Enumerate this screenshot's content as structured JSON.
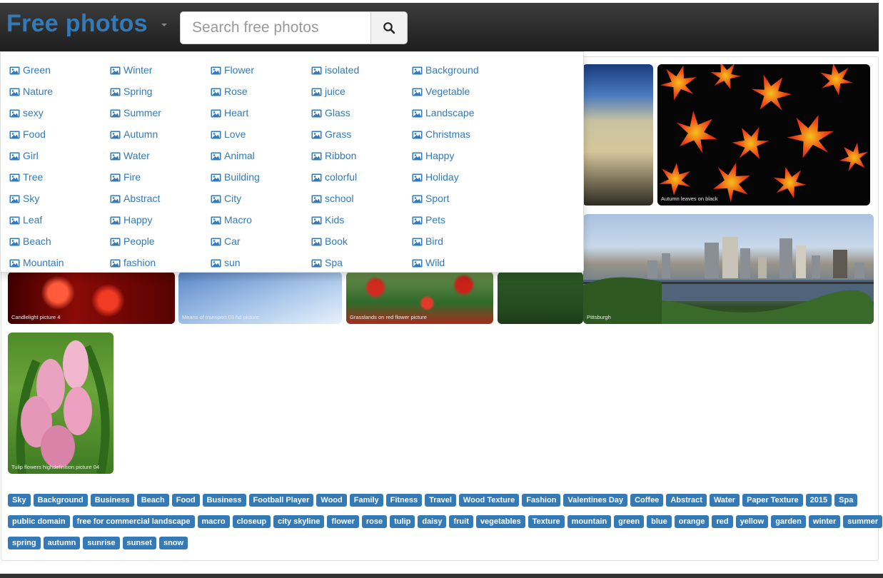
{
  "header": {
    "brand": "Free photos",
    "search_placeholder": "Search free photos"
  },
  "dropdown": {
    "columns": [
      [
        "Green",
        "Nature",
        "sexy",
        "Food",
        "Girl",
        "Tree",
        "Sky",
        "Leaf",
        "Beach",
        "Mountain"
      ],
      [
        "Winter",
        "Spring",
        "Summer",
        "Autumn",
        "Water",
        "Fire",
        "Abstract",
        "Happy",
        "People",
        "fashion"
      ],
      [
        "Flower",
        "Rose",
        "Heart",
        "Love",
        "Animal",
        "Building",
        "City",
        "Macro",
        "Car",
        "sun"
      ],
      [
        "isolated",
        "juice",
        "Glass",
        "Grass",
        "Ribbon",
        "colorful",
        "school",
        "Kids",
        "Book",
        "Spa"
      ],
      [
        "Background",
        "Vegetable",
        "Landscape",
        "Christmas",
        "Happy",
        "Holiday",
        "Sport",
        "Pets",
        "Bird",
        "Wild"
      ]
    ]
  },
  "photos": {
    "leaves": "Autumn leaves on black",
    "candle": "Candlelight picture 4",
    "plane": "Means of transport 03 hd picture",
    "flower": "Grasslands on red flower picture",
    "city": "Pittsburgh",
    "tulip": "Tulip flowers highdefinition picture 04"
  },
  "tags": {
    "row1": [
      "Sky",
      "Background",
      "Business",
      "Beach",
      "Food",
      "Business",
      "Football Player",
      "Wood",
      "Family",
      "Fitness",
      "Travel",
      "Wood Texture",
      "Fashion",
      "Valentines Day",
      "Coffee",
      "Abstract",
      "Water",
      "Paper Texture",
      "2015",
      "Spa"
    ],
    "row2": [
      "public domain",
      "free for commercial landscape",
      "macro",
      "closeup",
      "city skyline",
      "flower",
      "rose",
      "tulip",
      "daisy",
      "fruit",
      "vegetables",
      "Texture",
      "mountain",
      "green",
      "blue",
      "orange",
      "red",
      "yellow",
      "garden",
      "winter",
      "summer"
    ],
    "row3": [
      "spring",
      "autumn",
      "sunrise",
      "sunset",
      "snow"
    ]
  },
  "colors": {
    "accent": "#337ab7",
    "topbar": "#2b2b2b"
  }
}
